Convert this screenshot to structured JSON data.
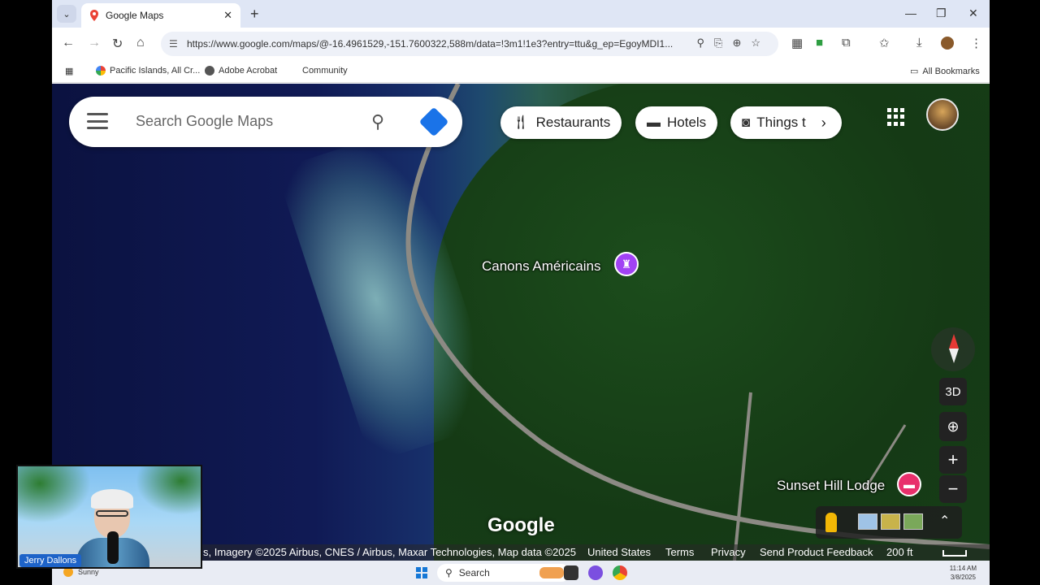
{
  "browser": {
    "tab_title": "Google Maps",
    "url": "https://www.google.com/maps/@-16.4961529,-151.7600322,588m/data=!3m1!1e3?entry=ttu&g_ep=EgoyMDI1...",
    "bookmarks": [
      "Pacific Islands, All Cr...",
      "Adobe Acrobat",
      "Community"
    ],
    "all_bookmarks": "All Bookmarks"
  },
  "maps": {
    "search_placeholder": "Search Google Maps",
    "chips": [
      "Restaurants",
      "Hotels",
      "Things t"
    ],
    "places": {
      "canons": "Canons Américains",
      "sunset": "Sunset Hill Lodge"
    },
    "controls": {
      "three_d": "3D",
      "zoom_in": "+",
      "zoom_out": "−"
    },
    "logo": "Google",
    "footer": {
      "attribution": "s, Imagery ©2025 Airbus, CNES / Airbus, Maxar Technologies, Map data ©2025",
      "country": "United States",
      "terms": "Terms",
      "privacy": "Privacy",
      "feedback": "Send Product Feedback",
      "scale": "200 ft"
    }
  },
  "webcam": {
    "name": "Jerry Dallons"
  },
  "taskbar": {
    "weather": "Sunny",
    "search": "Search",
    "time": "11:14 AM",
    "date": "3/8/2025"
  },
  "colors": {
    "maps_blue": "#1a73e8",
    "pin_purple": "#a142f4",
    "pin_pink": "#e8306c"
  }
}
